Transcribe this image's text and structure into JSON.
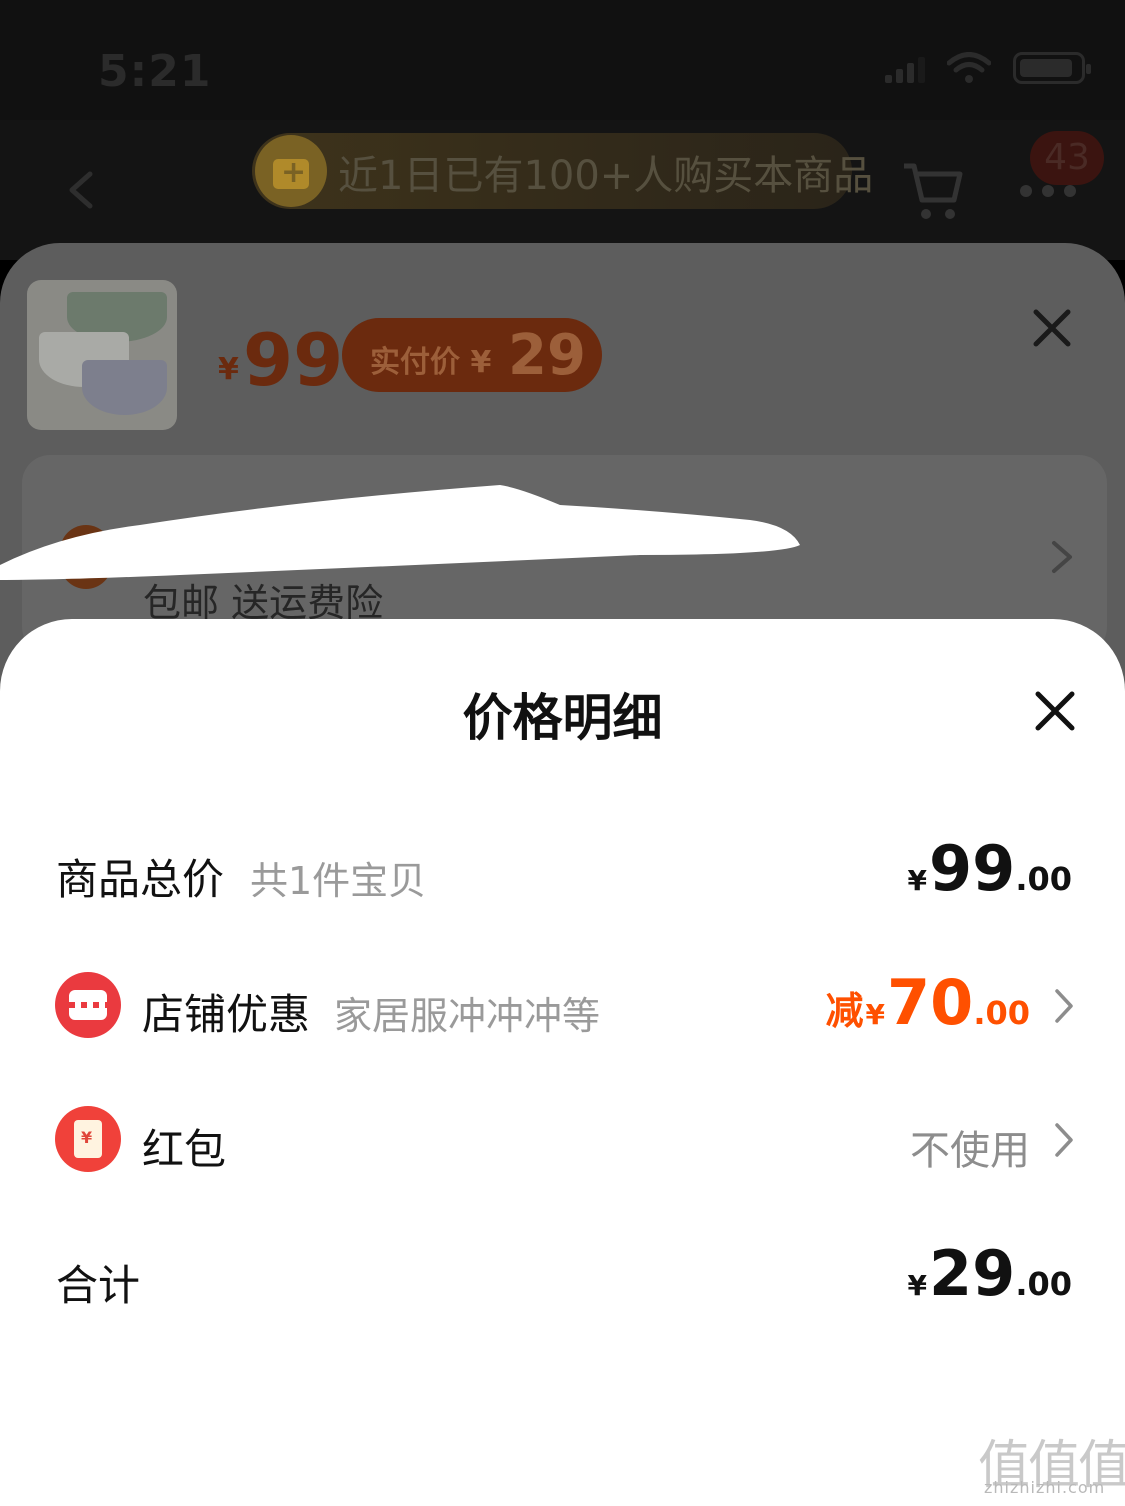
{
  "status_bar": {
    "time": "5:21"
  },
  "nav": {
    "banner_text": "近1日已有100+人购买本商品",
    "cart_count": "43"
  },
  "sku_sheet": {
    "price_symbol": "¥",
    "price": "99",
    "real_price_label": "实付价 ¥",
    "real_price": "29",
    "delivery_text": "包邮 送运费险"
  },
  "detail": {
    "title": "价格明细",
    "rows": [
      {
        "label": "商品总价",
        "sub": "共1件宝贝",
        "yen": "¥",
        "int": "99",
        "dec": ".00"
      },
      {
        "label": "店铺优惠",
        "sub": "家居服冲冲冲等",
        "prefix": "减",
        "yen": "¥",
        "int": "70",
        "dec": ".00"
      },
      {
        "label": "红包",
        "value": "不使用"
      },
      {
        "label": "合计",
        "yen": "¥",
        "int": "29",
        "dec": ".00"
      }
    ]
  },
  "watermark": {
    "glyphs": "值值值",
    "url": "zhizhizhi.com"
  },
  "colors": {
    "accent": "#ff5000",
    "shop_icon": "#ea3a3f",
    "red_packet": "#f0413a"
  }
}
